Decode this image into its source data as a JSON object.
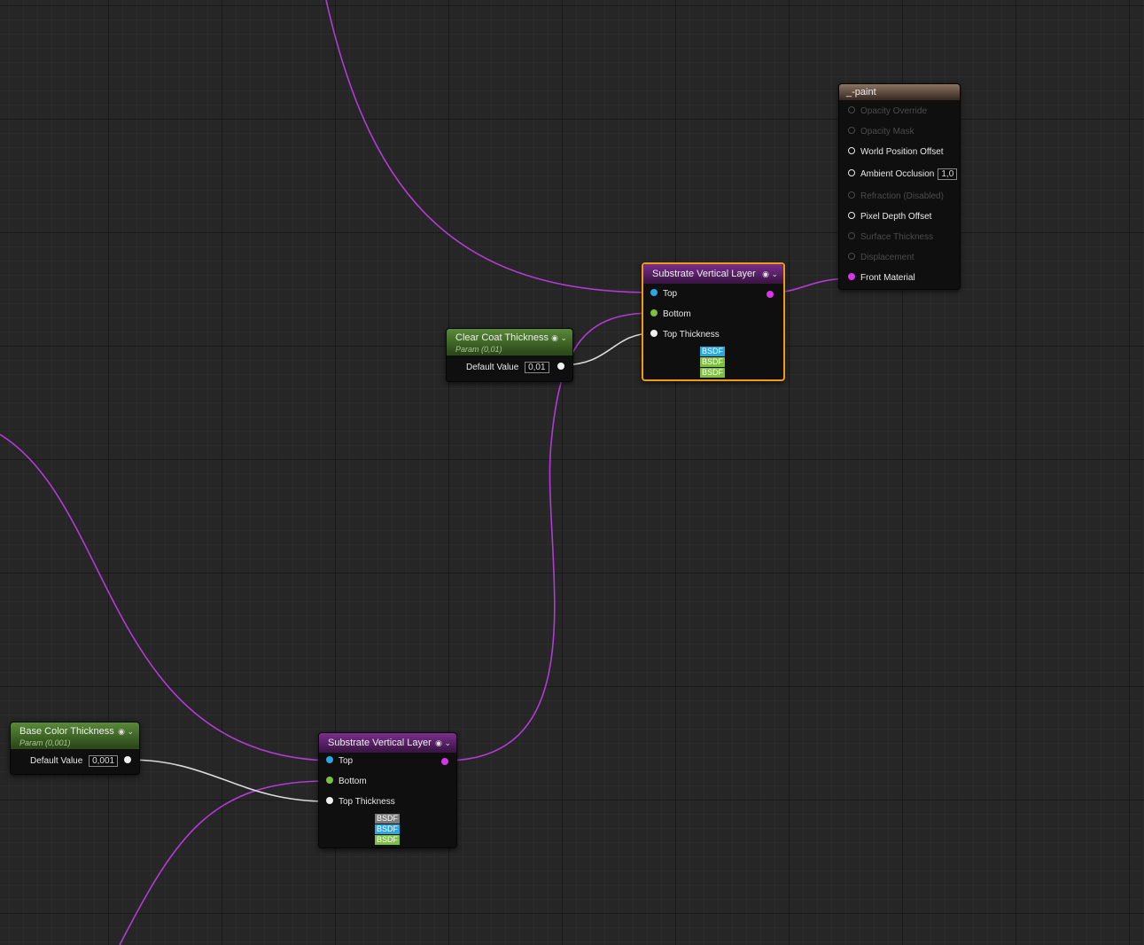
{
  "colors": {
    "wire_material": "#b23bd6",
    "wire_float": "#d9d9d9",
    "selection": "#f19a14",
    "bsdf_blue": "#2aa7e0",
    "bsdf_green": "#7fbf3f",
    "bsdf_gray": "#7b7b7b"
  },
  "material_output": {
    "title": "_-paint",
    "pins": [
      {
        "label": "Opacity Override",
        "enabled": false
      },
      {
        "label": "Opacity Mask",
        "enabled": false
      },
      {
        "label": "World Position Offset",
        "enabled": true
      },
      {
        "label": "Ambient Occlusion",
        "enabled": true,
        "value": "1,0"
      },
      {
        "label": "Refraction (Disabled)",
        "enabled": false
      },
      {
        "label": "Pixel Depth Offset",
        "enabled": true
      },
      {
        "label": "Surface Thickness",
        "enabled": false
      },
      {
        "label": "Displacement",
        "enabled": false
      },
      {
        "label": "Front Material",
        "enabled": true
      }
    ]
  },
  "layer_top": {
    "title": "Substrate Vertical Layer",
    "pins": [
      "Top",
      "Bottom",
      "Top Thickness"
    ],
    "tags": [
      "BSDF",
      "BSDF",
      "BSDF"
    ]
  },
  "layer_bottom": {
    "title": "Substrate Vertical Layer",
    "pins": [
      "Top",
      "Bottom",
      "Top Thickness"
    ],
    "tags": [
      "BSDF",
      "BSDF",
      "BSDF"
    ]
  },
  "clear_coat": {
    "title": "Clear Coat Thickness",
    "subtitle": "Param (0,01)",
    "default_label": "Default Value",
    "default_value": "0,01"
  },
  "base_color": {
    "title": "Base Color Thickness",
    "subtitle": "Param (0,001)",
    "default_label": "Default Value",
    "default_value": "0,001"
  },
  "icons": {
    "node_controls": "circle-chevron-icon"
  }
}
